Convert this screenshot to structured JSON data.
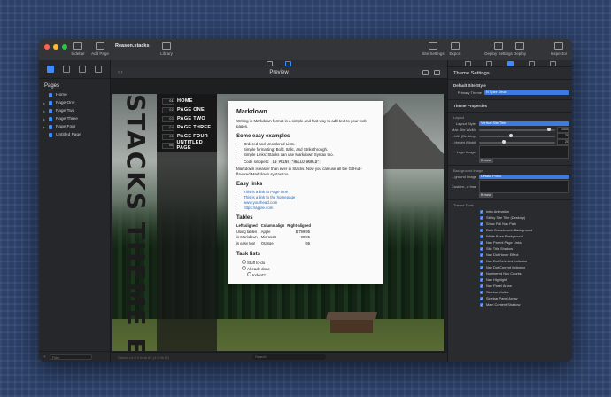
{
  "window": {
    "document_title": "Reason.stacks",
    "toolbar": {
      "sidebar": "Sidebar",
      "add_page": "Add Page",
      "library": "Library",
      "site_settings": "Site Settings",
      "export": "Export",
      "deploy_settings": "Deploy Settings",
      "deploy": "Deploy",
      "inspector": "Inspector"
    }
  },
  "sidebar": {
    "heading": "Pages",
    "pages": [
      {
        "label": "Home",
        "expandable": false
      },
      {
        "label": "Page One",
        "expandable": true
      },
      {
        "label": "Page Two",
        "expandable": true
      },
      {
        "label": "Page Three",
        "expandable": true
      },
      {
        "label": "Page Four",
        "expandable": true
      },
      {
        "label": "Untitled Page",
        "expandable": false
      }
    ],
    "filter_placeholder": "Filter"
  },
  "preview": {
    "title": "Preview",
    "site_title": "STACKS THEME E",
    "nav": [
      {
        "num": "01",
        "label": "HOME",
        "active": true
      },
      {
        "num": "02",
        "label": "PAGE ONE"
      },
      {
        "num": "03",
        "label": "PAGE TWO"
      },
      {
        "num": "04",
        "label": "PAGE THREE"
      },
      {
        "num": "05",
        "label": "PAGE FOUR"
      },
      {
        "num": "06",
        "label": "UNTITLED PAGE"
      }
    ],
    "card": {
      "h1": "Markdown",
      "intro": "Writing in Markdown format is a simple and fast way to add text to your web pages.",
      "h2_examples": "Some easy examples",
      "examples": [
        "Ordered and Unordered Lists.",
        "Simple formatting: Bold, Italic, and Strikethrough.",
        "Simple Links: Stacks can use Markdown Syntax too."
      ],
      "code_label": "Code snippets:",
      "code": "10 PRINT \"HELLO WORLD\"",
      "outro": "Markdown is easier than ever in Stacks. Now you can use all the GitHub-flavored Markdown syntax too.",
      "h2_links": "Easy links",
      "links": [
        "This is a link to Page One",
        "This is a link to the homepage",
        "www.yourhead.com",
        "https://apple.com"
      ],
      "h2_tables": "Tables",
      "table_headers": [
        "Left-aligned",
        "Column align",
        "Right-aligned"
      ],
      "table_rows": [
        [
          "Using tables",
          "Apple",
          "$ 799.95"
        ],
        [
          "in Markdown",
          "Microsoft",
          "99.95"
        ],
        [
          "is easy too!",
          "Orange",
          ".95"
        ]
      ],
      "h2_tasks": "Task lists",
      "tasks": [
        "Stuff to-do",
        "Already done",
        "Indent?"
      ]
    },
    "status_left": "Stacks v4.0.0 beta 83 (4.0.0b19)",
    "search_placeholder": "Search"
  },
  "inspector": {
    "title": "Theme Settings",
    "default_site_style": "Default Site Style",
    "primary_theme_label": "Primary Theme",
    "primary_theme_value": "N Spire Deux",
    "theme_properties": "Theme Properties",
    "layout_section": "Layout",
    "layout_style_label": "Layout Style:",
    "layout_style_value": "Vertical Site Title",
    "max_site_width_label": "Max Site Width:",
    "max_site_width_value": "1000",
    "width_desktop_label": "...idth (Desktop):",
    "width_desktop_value": "28",
    "height_mobile_label": "...Height (Mobile):",
    "height_mobile_value": "20",
    "logo_image_label": "Logo Image:",
    "browse": "Browse",
    "background_section": "Background image",
    "bg_image_label": "...ground Image:",
    "bg_image_value": "Default Photo",
    "custom_image_label": "Custom...d Image:",
    "browse2": "Browse",
    "toggles_section": "Theme Tools",
    "toggles": [
      "Intro Animation",
      "Sticky Site Title (Desktop)",
      "Show Full Nav Path",
      "Dark Breadcrumb Background",
      "White Base Background",
      "Nav Parent Page Links",
      "Site Title Shadow",
      "Nav Dot Hover Effect",
      "Nav Dot Selected Indicator",
      "Nav Dot Current Indicator",
      "Numbered Nav Counts",
      "Nav Highlight",
      "Nav Panel Arrow",
      "Sidebar Visible",
      "Sidebar Panel Arrow",
      "Main Content Shadow"
    ]
  },
  "colors": {
    "accent": "#3d8bff",
    "background": "#2c416a"
  }
}
